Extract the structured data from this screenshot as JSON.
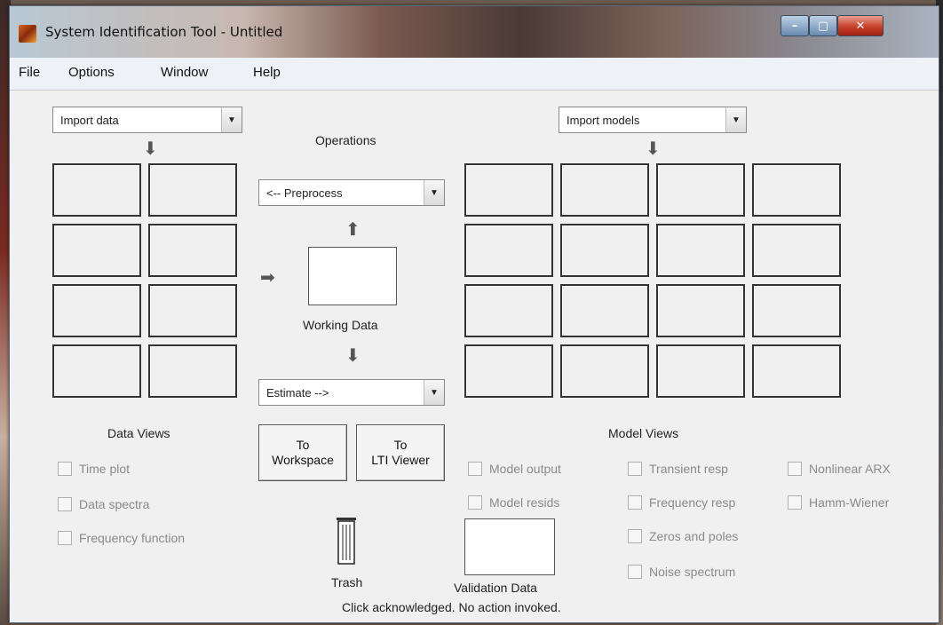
{
  "window": {
    "title": "System Identification Tool - Untitled",
    "controls": {
      "minimize": "–",
      "maximize": "▢",
      "close": "✕"
    }
  },
  "menu": [
    "File",
    "Options",
    "Window",
    "Help"
  ],
  "data_panel": {
    "import_dropdown": "Import data",
    "title": "Data Views",
    "checkboxes": [
      "Time plot",
      "Data spectra",
      "Frequency function"
    ]
  },
  "operations": {
    "title": "Operations",
    "preprocess_dropdown": "<-- Preprocess",
    "working_data_label": "Working Data",
    "estimate_dropdown": "Estimate -->",
    "to_workspace": {
      "line1": "To",
      "line2": "Workspace"
    },
    "to_lti_viewer": {
      "line1": "To",
      "line2": "LTI Viewer"
    },
    "trash_label": "Trash"
  },
  "model_panel": {
    "import_dropdown": "Import models",
    "title": "Model Views",
    "checkboxes_col1": [
      "Model output",
      "Model resids"
    ],
    "checkboxes_col2": [
      "Transient resp",
      "Frequency resp",
      "Zeros and poles",
      "Noise spectrum"
    ],
    "checkboxes_col3": [
      "Nonlinear ARX",
      "Hamm-Wiener"
    ],
    "validation_label": "Validation Data"
  },
  "status": "Click acknowledged. No action invoked.",
  "icons": {
    "down_arrow": "arrow-down-icon",
    "up_arrow": "arrow-up-icon",
    "right_arrow": "arrow-right-icon",
    "dropdown": "chevron-down-icon"
  }
}
